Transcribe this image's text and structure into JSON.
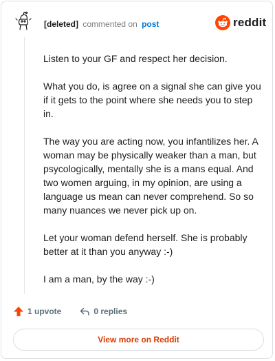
{
  "header": {
    "author": "[deleted]",
    "commented_text": "commented on",
    "post_link": "post"
  },
  "brand": {
    "wordmark": "reddit",
    "icon": "reddit-snoo-icon",
    "color": "#ff4500"
  },
  "comment": {
    "paragraphs": [
      "Listen to your GF and respect her decision.",
      "What you do, is agree on a signal she can give you if it gets to the point where she needs you to step in.",
      "The way you are acting now, you infantilizes her. A woman may be physically weaker than a man, but psycologically, mentally she is a mans equal. And two women arguing, in my opinion, are using a language us mean can never comprehend. So so many nuances we never pick up on.",
      "Let your woman defend herself. She is probably better at it than you anyway :-)",
      "I am a man, by the way :-)"
    ]
  },
  "actions": {
    "upvote_label": "1 upvote",
    "upvote_icon": "upvote-arrow-icon",
    "upvote_color": "#ff4500",
    "replies_label": "0 replies",
    "replies_icon": "reply-arrow-icon"
  },
  "footer": {
    "view_more_label": "View more on Reddit",
    "view_more_color": "#d93a00"
  }
}
